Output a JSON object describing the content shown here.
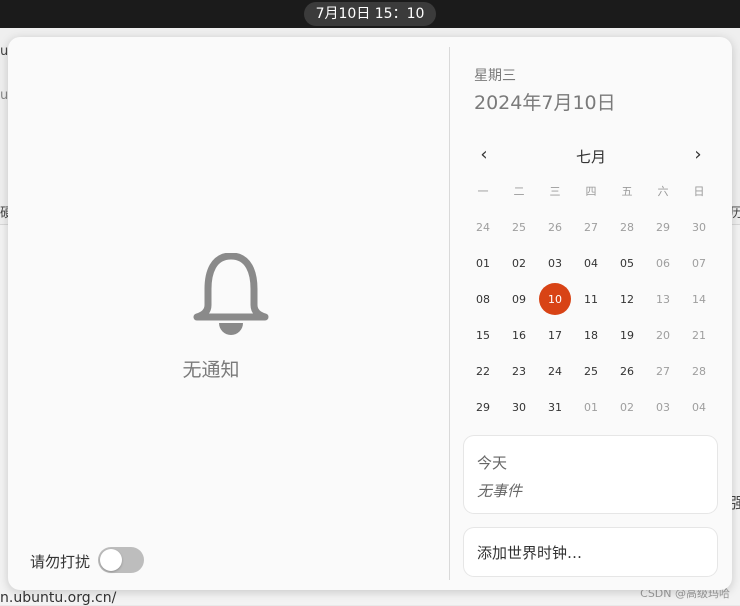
{
  "topbar": {
    "clock": "7月10日  15：10"
  },
  "notifications": {
    "empty_label": "无通知",
    "dnd_label": "请勿打扰",
    "dnd_enabled": false
  },
  "calendar": {
    "weekday": "星期三",
    "full_date": "2024年7月10日",
    "month": "七月",
    "prev_label": "‹",
    "next_label": "›",
    "weekday_headers": [
      "一",
      "二",
      "三",
      "四",
      "五",
      "六",
      "日"
    ],
    "weeks": [
      [
        "24",
        "25",
        "26",
        "27",
        "28",
        "29",
        "30"
      ],
      [
        "01",
        "02",
        "03",
        "04",
        "05",
        "06",
        "07"
      ],
      [
        "08",
        "09",
        "10",
        "11",
        "12",
        "13",
        "14"
      ],
      [
        "15",
        "16",
        "17",
        "18",
        "19",
        "20",
        "21"
      ],
      [
        "22",
        "23",
        "24",
        "25",
        "26",
        "27",
        "28"
      ],
      [
        "29",
        "30",
        "31",
        "01",
        "02",
        "03",
        "04"
      ]
    ],
    "today": "10"
  },
  "events": {
    "title": "今天",
    "empty": "无事件"
  },
  "world_clocks": {
    "add_label": "添加世界时钟…"
  },
  "background": {
    "url_fragment": "n.ubuntu.org.cn/",
    "left_fragments": [
      "ub",
      "u",
      "硬"
    ],
    "right_fragments": [
      "历",
      "强"
    ]
  },
  "watermark": "CSDN @高级玛哈"
}
